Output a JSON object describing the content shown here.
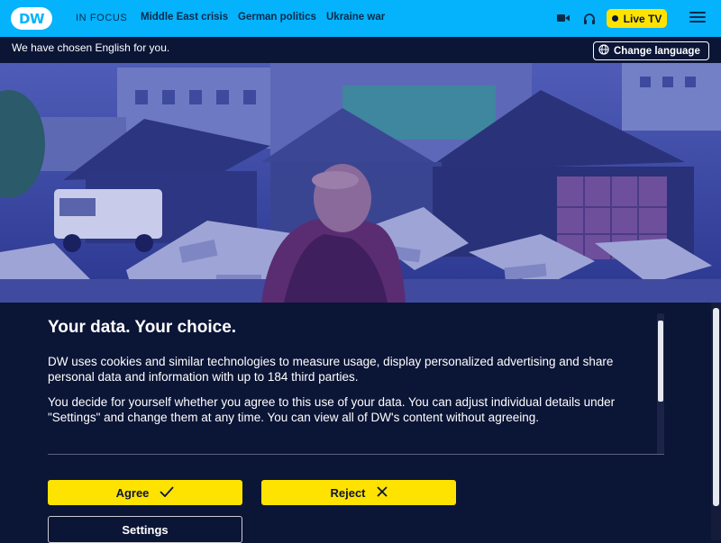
{
  "header": {
    "logo_text": "DW",
    "in_focus_label": "IN FOCUS",
    "nav_links": [
      "Middle East crisis",
      "German politics",
      "Ukraine war"
    ],
    "video_icon": "video-camera-icon",
    "audio_icon": "headphones-icon",
    "live_tv_label": "Live TV",
    "menu_icon": "hamburger-menu-icon"
  },
  "language_bar": {
    "message": "We have chosen English for you.",
    "change_language_label": "Change language",
    "globe_icon": "globe-icon"
  },
  "consent": {
    "title": "Your data. Your choice.",
    "paragraph_1": "DW uses cookies and similar technologies to measure usage, display personalized advertising and share personal data and information with up to 184 third parties.",
    "paragraph_2": "You decide for yourself whether you agree to this use of your data. You can adjust individual details under \"Settings\" and change them at any time. You can view all of DW's content without agreeing.",
    "agree_label": "Agree",
    "reject_label": "Reject",
    "settings_label": "Settings"
  },
  "colors": {
    "brand_blue": "#05b2fc",
    "accent_yellow": "#ffe300",
    "dark_navy": "#0b1536"
  }
}
